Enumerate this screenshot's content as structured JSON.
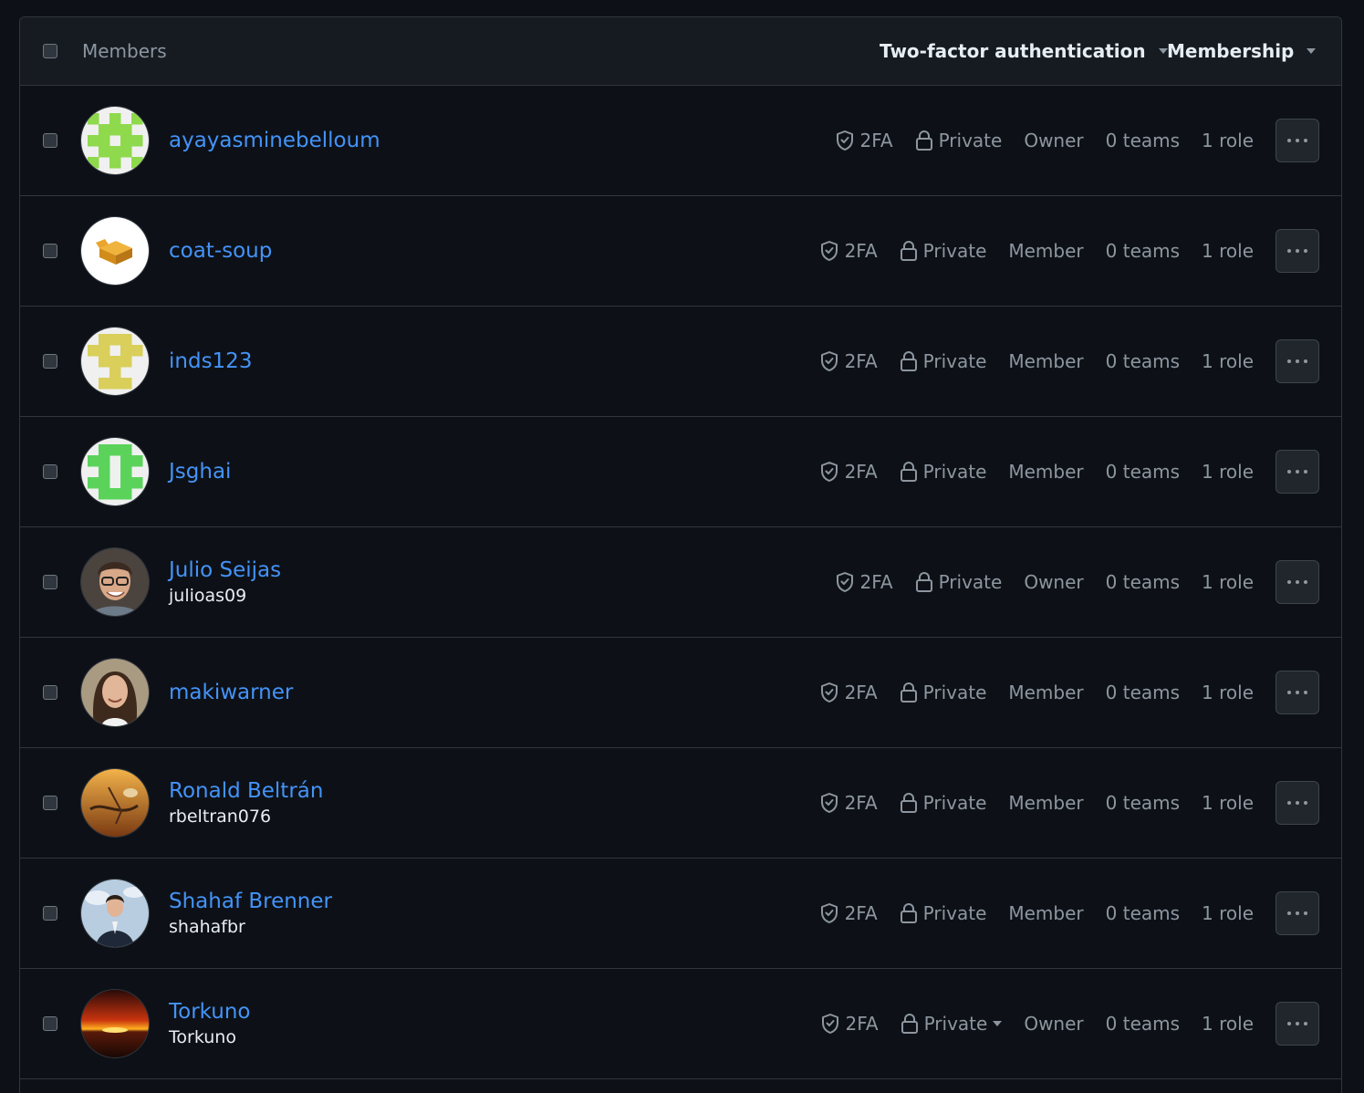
{
  "header": {
    "title": "Members",
    "two_factor_filter": "Two-factor authentication",
    "membership_filter": "Membership"
  },
  "labels": {
    "twofa": "2FA",
    "teams": "0 teams",
    "roles": "1 role"
  },
  "colors": {
    "background": "#0d1117",
    "header_bg": "#161b22",
    "border": "#30363d",
    "link": "#4493f8",
    "muted": "#8d96a0"
  },
  "members": [
    {
      "display_name": "ayayasminebelloum",
      "username": "",
      "twofa": "2FA",
      "visibility": "Private",
      "role": "Owner",
      "teams": "0 teams",
      "roles": "1 role",
      "avatar": "identicon-green"
    },
    {
      "display_name": "coat-soup",
      "username": "",
      "twofa": "2FA",
      "visibility": "Private",
      "role": "Member",
      "teams": "0 teams",
      "roles": "1 role",
      "avatar": "box-icon"
    },
    {
      "display_name": "inds123",
      "username": "",
      "twofa": "2FA",
      "visibility": "Private",
      "role": "Member",
      "teams": "0 teams",
      "roles": "1 role",
      "avatar": "identicon-olive"
    },
    {
      "display_name": "Jsghai",
      "username": "",
      "twofa": "2FA",
      "visibility": "Private",
      "role": "Member",
      "teams": "0 teams",
      "roles": "1 role",
      "avatar": "identicon-green-2"
    },
    {
      "display_name": "Julio Seijas",
      "username": "julioas09",
      "twofa": "2FA",
      "visibility": "Private",
      "role": "Owner",
      "teams": "0 teams",
      "roles": "1 role",
      "avatar": "photo-man-glasses"
    },
    {
      "display_name": "makiwarner",
      "username": "",
      "twofa": "2FA",
      "visibility": "Private",
      "role": "Member",
      "teams": "0 teams",
      "roles": "1 role",
      "avatar": "photo-woman"
    },
    {
      "display_name": "Ronald Beltrán",
      "username": "rbeltran076",
      "twofa": "2FA",
      "visibility": "Private",
      "role": "Member",
      "teams": "0 teams",
      "roles": "1 role",
      "avatar": "photo-surreal-art"
    },
    {
      "display_name": "Shahaf Brenner",
      "username": "shahafbr",
      "twofa": "2FA",
      "visibility": "Private",
      "role": "Member",
      "teams": "0 teams",
      "roles": "1 role",
      "avatar": "photo-man-suit"
    },
    {
      "display_name": "Torkuno",
      "username": "Torkuno",
      "twofa": "2FA",
      "visibility": "Private",
      "role": "Owner",
      "teams": "0 teams",
      "roles": "1 role",
      "avatar": "photo-sunset",
      "visibility_dropdown": true
    }
  ]
}
